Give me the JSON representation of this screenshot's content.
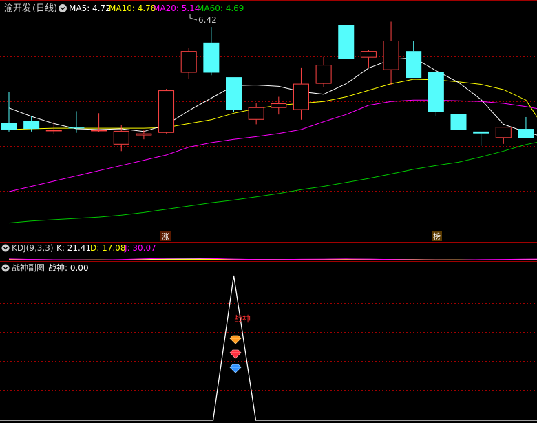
{
  "colors": {
    "up": "#ff4444",
    "down": "#54fcfc",
    "ma5": "#ffffff",
    "ma10": "#ffff00",
    "ma20": "#ff00ff",
    "ma60": "#00c800",
    "grid": "#a00000",
    "k": "#ffffff",
    "d": "#ffff00",
    "j": "#ff00ff",
    "zhanshen": "#ffffff",
    "signal": "#ff3030",
    "text": "#c8c8c8"
  },
  "main_panel": {
    "stock_name": "渝开发",
    "period": "(日线)",
    "ma5_label": "MA5: 4.72",
    "ma10_label": "MA10: 4.78",
    "ma20_label": "MA20: 5.14",
    "ma60_label": "MA60: 4.69",
    "high_marker": "6.42",
    "marker_zhang": "涨",
    "marker_bang": "榜",
    "collapse_icon": "chevron-down-icon"
  },
  "kdj_panel": {
    "title": "KDJ(9,3,3)",
    "k_label": "K: 21.41",
    "d_label": "D: 17.08",
    "j_label": "J: 30.07"
  },
  "zhanshen_panel": {
    "title": "战神副图",
    "value_label": "战神: 0.00",
    "signal_label": "战神"
  },
  "chart_data": [
    {
      "type": "candlestick",
      "ylim": [
        3.3,
        6.6
      ],
      "candles": [
        {
          "o": 4.95,
          "h": 5.42,
          "l": 4.82,
          "c": 4.85
        },
        {
          "o": 4.98,
          "h": 5.05,
          "l": 4.82,
          "c": 4.86
        },
        {
          "o": 4.84,
          "h": 4.97,
          "l": 4.78,
          "c": 4.84
        },
        {
          "o": 4.88,
          "h": 5.13,
          "l": 4.8,
          "c": 4.87
        },
        {
          "o": 4.84,
          "h": 5.1,
          "l": 4.81,
          "c": 4.84
        },
        {
          "o": 4.62,
          "h": 4.92,
          "l": 4.52,
          "c": 4.83
        },
        {
          "o": 4.76,
          "h": 4.85,
          "l": 4.7,
          "c": 4.79
        },
        {
          "o": 4.8,
          "h": 5.47,
          "l": 4.79,
          "c": 5.45
        },
        {
          "o": 5.72,
          "h": 6.1,
          "l": 5.62,
          "c": 6.05
        },
        {
          "o": 6.18,
          "h": 6.42,
          "l": 5.68,
          "c": 5.72
        },
        {
          "o": 5.65,
          "h": 5.65,
          "l": 5.12,
          "c": 5.15
        },
        {
          "o": 5.0,
          "h": 5.25,
          "l": 4.93,
          "c": 5.19
        },
        {
          "o": 5.18,
          "h": 5.35,
          "l": 5.08,
          "c": 5.25
        },
        {
          "o": 5.15,
          "h": 5.8,
          "l": 5.0,
          "c": 5.55
        },
        {
          "o": 5.55,
          "h": 5.96,
          "l": 5.5,
          "c": 5.84
        },
        {
          "o": 6.45,
          "h": 6.45,
          "l": 5.93,
          "c": 5.93
        },
        {
          "o": 5.95,
          "h": 6.07,
          "l": 5.8,
          "c": 6.05
        },
        {
          "o": 5.76,
          "h": 6.5,
          "l": 5.53,
          "c": 6.21
        },
        {
          "o": 6.05,
          "h": 6.21,
          "l": 5.64,
          "c": 5.64
        },
        {
          "o": 5.73,
          "h": 5.75,
          "l": 5.06,
          "c": 5.12
        },
        {
          "o": 5.09,
          "h": 5.09,
          "l": 4.84,
          "c": 4.84
        },
        {
          "o": 4.82,
          "h": 4.82,
          "l": 4.6,
          "c": 4.79
        },
        {
          "o": 4.72,
          "h": 4.86,
          "l": 4.63,
          "c": 4.89
        },
        {
          "o": 4.86,
          "h": 5.04,
          "l": 4.8,
          "c": 4.72
        },
        {
          "o": 4.72,
          "h": 4.75,
          "l": 4.62,
          "c": 4.7
        }
      ],
      "ma5": [
        5.18,
        5.05,
        4.94,
        4.86,
        4.85,
        4.86,
        4.82,
        4.92,
        5.14,
        5.33,
        5.52,
        5.53,
        5.51,
        5.43,
        5.39,
        5.55,
        5.79,
        5.92,
        5.95,
        5.75,
        5.57,
        5.31,
        4.93,
        4.81,
        4.72
      ],
      "ma10": [
        4.85,
        4.86,
        4.87,
        4.87,
        4.87,
        4.87,
        4.87,
        4.88,
        4.94,
        5.0,
        5.1,
        5.17,
        5.22,
        5.25,
        5.28,
        5.35,
        5.45,
        5.55,
        5.62,
        5.61,
        5.58,
        5.54,
        5.46,
        5.3,
        4.78
      ],
      "ma20": [
        3.9,
        3.98,
        4.06,
        4.14,
        4.22,
        4.3,
        4.38,
        4.46,
        4.58,
        4.65,
        4.7,
        4.74,
        4.79,
        4.85,
        4.97,
        5.08,
        5.22,
        5.28,
        5.3,
        5.3,
        5.29,
        5.28,
        5.25,
        5.2,
        5.14
      ],
      "ma60": [
        3.42,
        3.45,
        3.47,
        3.49,
        3.51,
        3.54,
        3.58,
        3.63,
        3.68,
        3.73,
        3.77,
        3.82,
        3.87,
        3.93,
        3.98,
        4.04,
        4.1,
        4.17,
        4.24,
        4.3,
        4.35,
        4.43,
        4.52,
        4.62,
        4.69
      ]
    },
    {
      "type": "line",
      "series": [
        {
          "name": "K",
          "values": [
            25,
            22,
            20,
            19,
            18,
            20,
            24,
            28,
            30,
            29,
            26,
            24,
            23,
            24,
            25,
            27,
            26,
            24,
            21,
            19,
            18,
            19,
            20,
            21,
            21.41
          ]
        },
        {
          "name": "D",
          "values": [
            22,
            21,
            20,
            19,
            19,
            19,
            20,
            22,
            24,
            25,
            25,
            24,
            23,
            23,
            24,
            25,
            25,
            24,
            22,
            20,
            19,
            18,
            18,
            18,
            17.08
          ]
        },
        {
          "name": "J",
          "values": [
            31,
            24,
            20,
            19,
            16,
            22,
            32,
            40,
            42,
            37,
            28,
            24,
            23,
            26,
            27,
            31,
            28,
            24,
            19,
            17,
            16,
            21,
            24,
            27,
            30.07
          ]
        }
      ]
    },
    {
      "type": "line",
      "series": [
        {
          "name": "战神",
          "values": [
            0,
            0,
            0,
            0,
            0,
            0,
            0,
            0,
            0,
            0,
            0,
            0,
            0,
            0,
            0,
            0,
            0,
            0,
            0,
            0,
            0,
            0,
            0,
            0,
            0
          ]
        }
      ],
      "spike_index": 10,
      "spike_value": 100
    }
  ]
}
